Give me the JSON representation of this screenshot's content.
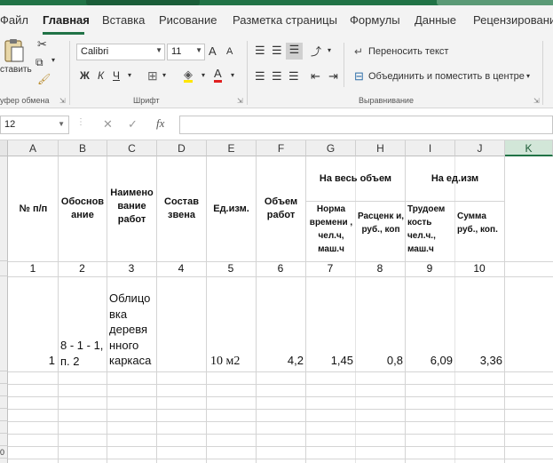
{
  "ribbon_tabs": [
    "Файл",
    "Главная",
    "Вставка",
    "Рисование",
    "Разметка страницы",
    "Формулы",
    "Данные",
    "Рецензирование"
  ],
  "ribbon": {
    "paste_label": "ставить",
    "clipboard_group": "уфер обмена",
    "font_name": "Calibri",
    "font_size": "11",
    "font_group": "Шрифт",
    "bold": "Ж",
    "italic": "К",
    "underline": "Ч",
    "grow_font": "A",
    "shrink_font": "A",
    "wrap_text": "Переносить текст",
    "merge_center": "Объединить и поместить в центре",
    "alignment_group": "Выравнивание"
  },
  "formula_bar": {
    "name_box": "12",
    "cancel_symbol": "✕",
    "enter_symbol": "✓",
    "fx_symbol": "fx",
    "formula": ""
  },
  "columns": [
    "A",
    "B",
    "C",
    "D",
    "E",
    "F",
    "G",
    "H",
    "I",
    "J",
    "K"
  ],
  "header_cells": {
    "a": "№ п/п",
    "b": "Обоснов ание",
    "c": "Наимено вание работ",
    "d": "Состав звена",
    "e": "Ед.изм.",
    "f": "Объем работ",
    "gh": "На весь объем",
    "ij": "На ед.изм",
    "g": "Норма времени , чел.ч, маш.ч",
    "h": "Расценк и, руб., коп",
    "i": "Трудоем кость чел.ч., маш.ч",
    "j": "Сумма руб., коп."
  },
  "col_numbers": [
    "1",
    "2",
    "3",
    "4",
    "5",
    "6",
    "7",
    "8",
    "9",
    "10"
  ],
  "data_row": {
    "a": "1",
    "b": "8 - 1 - 1, п. 2",
    "c": "Облицо вка деревя нного каркаса",
    "d": "",
    "e": "10 м2",
    "f": "4,2",
    "g": "1,45",
    "h": "0,8",
    "i": "6,09",
    "j": "3,36"
  },
  "row_headers": [
    "0"
  ],
  "colors": {
    "accent": "#217346",
    "ribbon_bg": "#f3f3f3",
    "selected_column": "#d2e6d8"
  }
}
